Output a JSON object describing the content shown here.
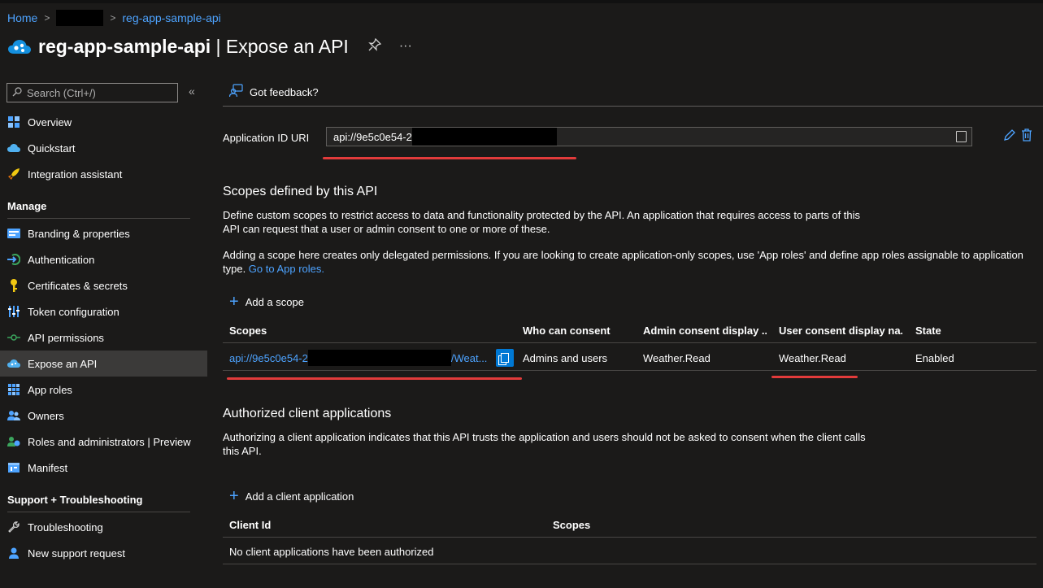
{
  "breadcrumb": {
    "home": "Home",
    "current": "reg-app-sample-api"
  },
  "title": {
    "app": "reg-app-sample-api",
    "separator": " | ",
    "page": "Expose an API",
    "pin_icon": "pin-icon",
    "more_icon": "more-icon",
    "more_label": "···"
  },
  "sidebar": {
    "search_placeholder": "Search (Ctrl+/)",
    "collapse_label": "«",
    "items_top": [
      {
        "label": "Overview",
        "icon": "overview-icon"
      },
      {
        "label": "Quickstart",
        "icon": "quickstart-icon"
      },
      {
        "label": "Integration assistant",
        "icon": "rocket-icon"
      }
    ],
    "manage_heading": "Manage",
    "items_manage": [
      {
        "label": "Branding & properties",
        "icon": "branding-icon"
      },
      {
        "label": "Authentication",
        "icon": "authentication-icon"
      },
      {
        "label": "Certificates & secrets",
        "icon": "key-icon"
      },
      {
        "label": "Token configuration",
        "icon": "token-icon"
      },
      {
        "label": "API permissions",
        "icon": "api-permissions-icon"
      },
      {
        "label": "Expose an API",
        "icon": "cloud-icon",
        "active": true
      },
      {
        "label": "App roles",
        "icon": "app-roles-icon"
      },
      {
        "label": "Owners",
        "icon": "owners-icon"
      },
      {
        "label": "Roles and administrators | Preview",
        "icon": "roles-icon"
      },
      {
        "label": "Manifest",
        "icon": "manifest-icon"
      }
    ],
    "support_heading": "Support + Troubleshooting",
    "items_support": [
      {
        "label": "Troubleshooting",
        "icon": "wrench-icon"
      },
      {
        "label": "New support request",
        "icon": "support-person-icon"
      }
    ]
  },
  "main": {
    "feedback_label": "Got feedback?",
    "app_id_uri_label": "Application ID URI",
    "app_id_uri_value": "api://9e5c0e54-2",
    "scopes_heading": "Scopes defined by this API",
    "scopes_desc_line1": "Define custom scopes to restrict access to data and functionality protected by the API. An application that requires access to parts of this",
    "scopes_desc_line2": "API can request that a user or admin consent to one or more of these.",
    "scopes_note_line1": "Adding a scope here creates only delegated permissions. If you are looking to create application-only scopes, use 'App roles' and define app roles assignable to application",
    "scopes_note_line2_prefix": "type. ",
    "scopes_note_link": "Go to App roles.",
    "add_scope_label": "Add a scope",
    "scopes_table": {
      "headers": [
        "Scopes",
        "Who can consent",
        "Admin consent display ...",
        "User consent display na...",
        "State"
      ],
      "rows": [
        {
          "scope_prefix": "api://9e5c0e54-2",
          "scope_suffix": "/Weat...",
          "who": "Admins and users",
          "admin_display": "Weather.Read",
          "user_display": "Weather.Read",
          "state": "Enabled"
        }
      ]
    },
    "auth_heading": "Authorized client applications",
    "auth_desc_line1": "Authorizing a client application indicates that this API trusts the application and users should not be asked to consent when the client calls",
    "auth_desc_line2": "this API.",
    "add_client_label": "Add a client application",
    "clients_table": {
      "headers": [
        "Client Id",
        "Scopes"
      ],
      "empty": "No client applications have been authorized"
    }
  },
  "colors": {
    "accent": "#0078d4",
    "link": "#4da3ff",
    "annotation": "#e23b3b",
    "background": "#1b1a19"
  }
}
